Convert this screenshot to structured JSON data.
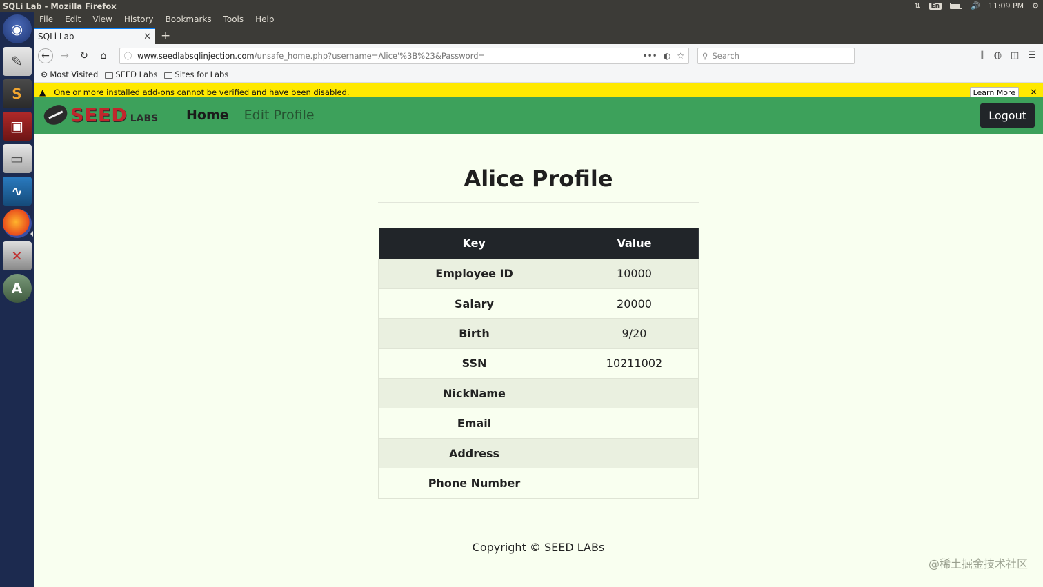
{
  "system": {
    "window_title": "SQLi Lab - Mozilla Firefox",
    "lang": "En",
    "time": "11:09 PM"
  },
  "launcher": {
    "apps": [
      "ubuntu-icon",
      "text-editor-icon",
      "sublime-icon",
      "terminal-icon",
      "files-icon",
      "wireshark-icon",
      "firefox-icon",
      "settings-icon",
      "updater-icon"
    ]
  },
  "browser": {
    "menu": [
      "File",
      "Edit",
      "View",
      "History",
      "Bookmarks",
      "Tools",
      "Help"
    ],
    "tab_title": "SQLi Lab",
    "url_host": "www.seedlabsqlinjection.com",
    "url_path": "/unsafe_home.php?username=Alice'%3B%23&Password=",
    "search_placeholder": "Search",
    "bookmarks": [
      "Most Visited",
      "SEED Labs",
      "Sites for Labs"
    ],
    "notification": "One or more installed add-ons cannot be verified and have been disabled.",
    "learn_more": "Learn More"
  },
  "site": {
    "logo_main": "SEED",
    "logo_sub": "LABS",
    "nav": {
      "home": "Home",
      "edit_profile": "Edit Profile",
      "logout": "Logout"
    },
    "title": "Alice Profile",
    "table": {
      "headers": [
        "Key",
        "Value"
      ],
      "rows": [
        {
          "key": "Employee ID",
          "value": "10000"
        },
        {
          "key": "Salary",
          "value": "20000"
        },
        {
          "key": "Birth",
          "value": "9/20"
        },
        {
          "key": "SSN",
          "value": "10211002"
        },
        {
          "key": "NickName",
          "value": ""
        },
        {
          "key": "Email",
          "value": ""
        },
        {
          "key": "Address",
          "value": ""
        },
        {
          "key": "Phone Number",
          "value": ""
        }
      ]
    },
    "copyright": "Copyright © SEED LABs",
    "watermark": "@稀土掘金技术社区"
  },
  "colors": {
    "nav_green": "#3da15b",
    "page_bg": "#f9fff0",
    "header_dark": "#212529",
    "notification_yellow": "#ffe900",
    "logo_red": "#c1272d"
  }
}
